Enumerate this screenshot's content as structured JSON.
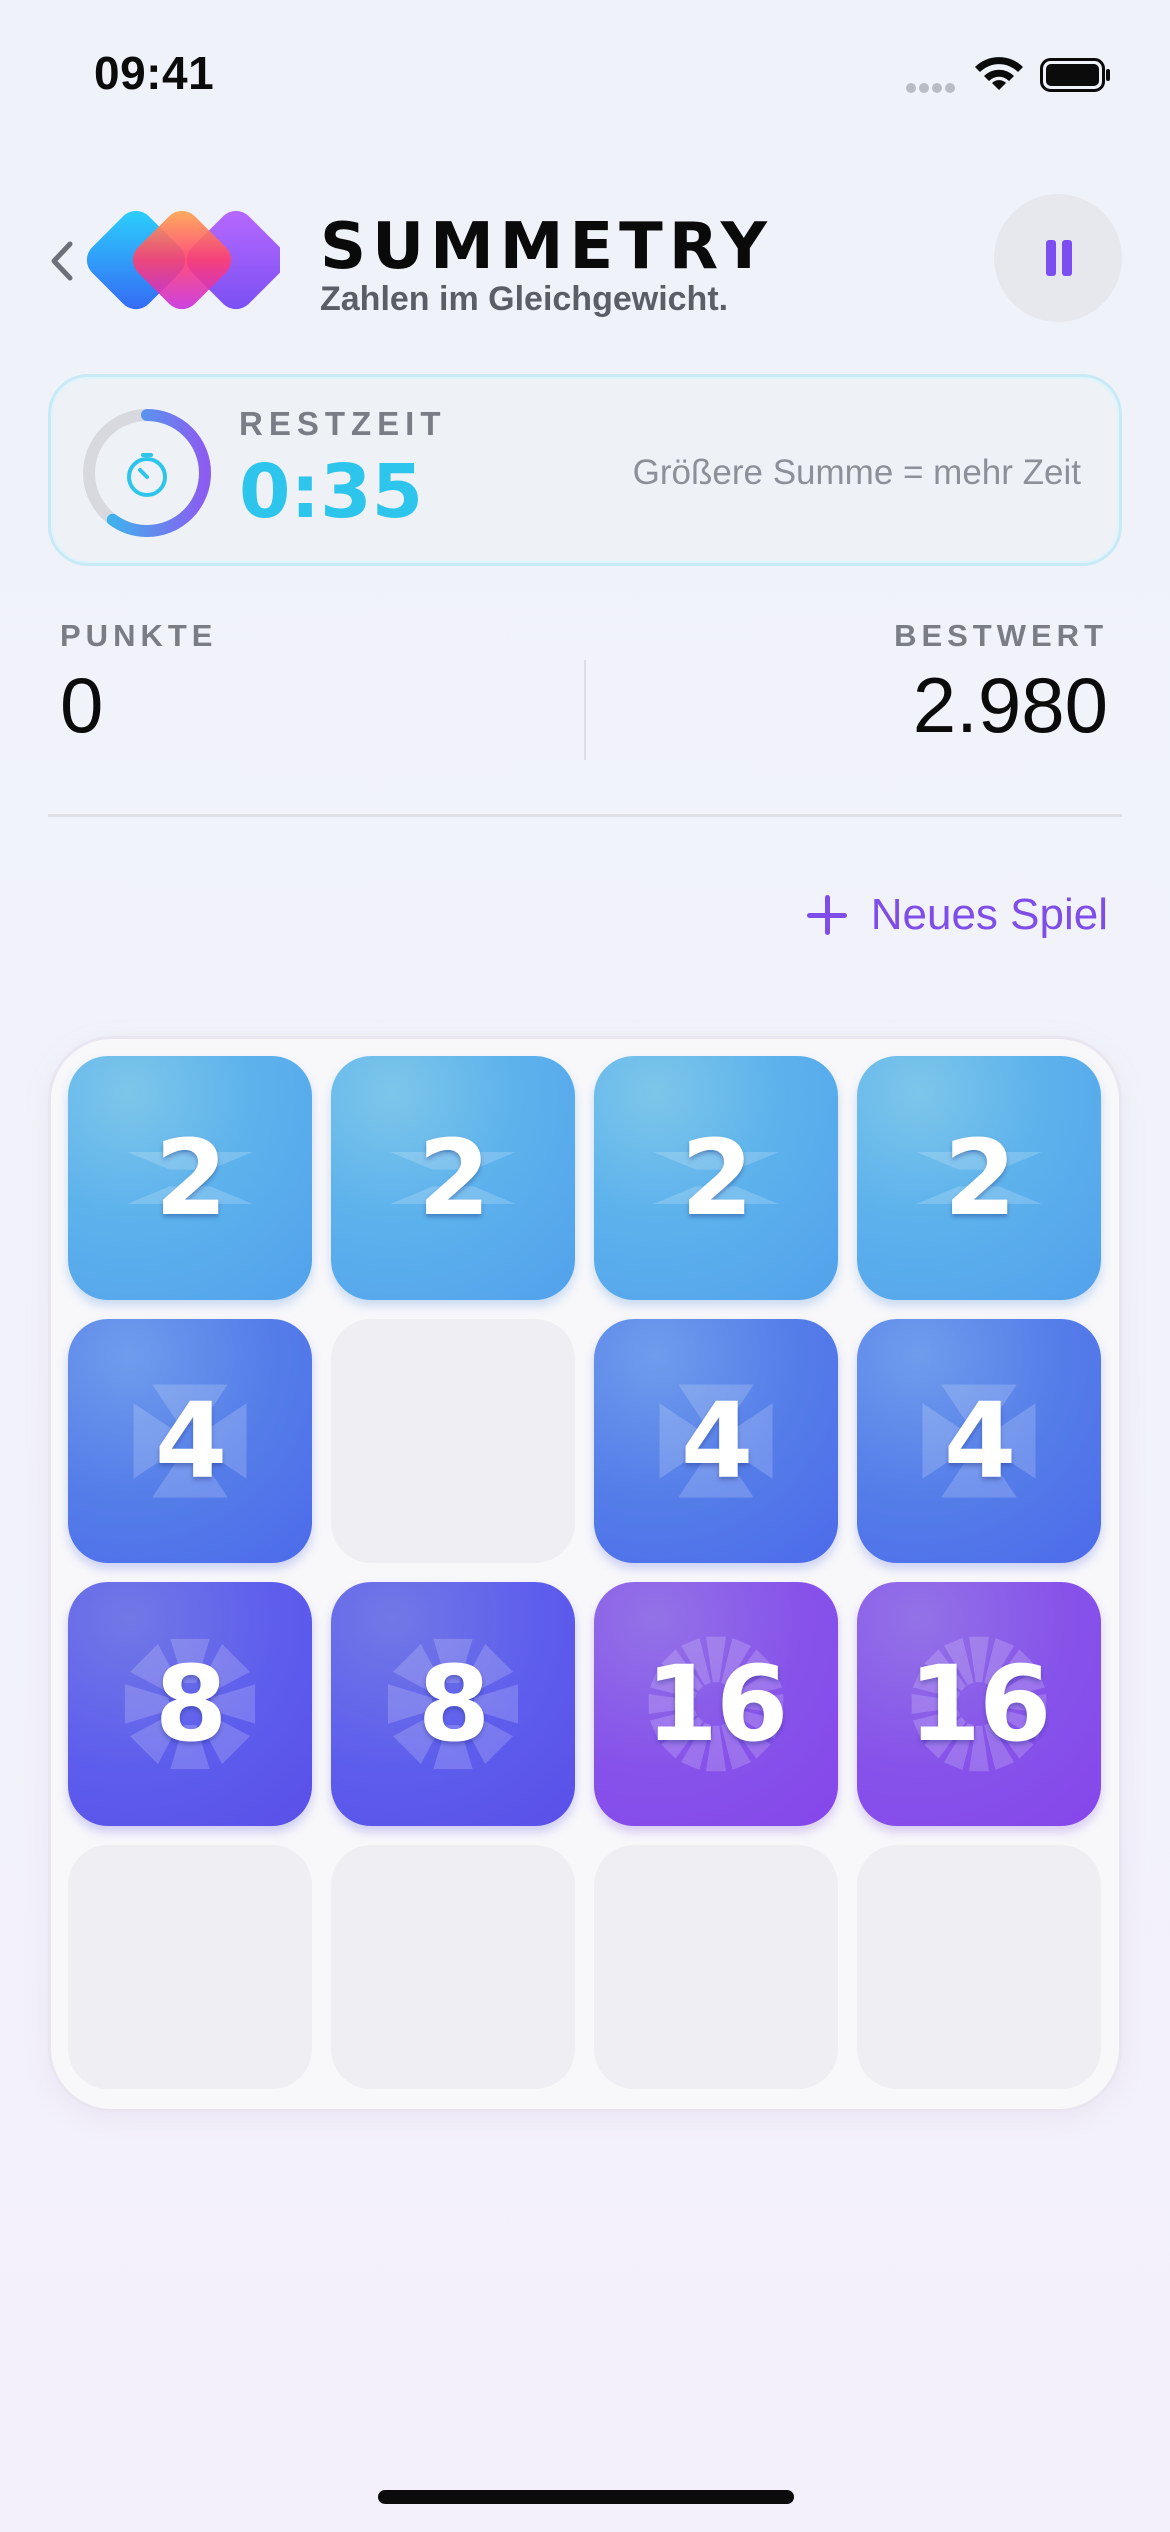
{
  "status_bar": {
    "time": "09:41"
  },
  "header": {
    "title": "SUMMETRY",
    "subtitle": "Zahlen im Gleichgewicht."
  },
  "timer": {
    "label": "RESTZEIT",
    "value": "0:35",
    "hint": "Größere Summe = mehr Zeit",
    "fraction_remaining": 0.6
  },
  "scores": {
    "points_label": "PUNKTE",
    "points_value": "0",
    "best_label": "BESTWERT",
    "best_value": "2.980"
  },
  "actions": {
    "new_game_label": "Neues Spiel"
  },
  "board": {
    "rows": [
      [
        "2",
        "2",
        "2",
        "2"
      ],
      [
        "4",
        "",
        "4",
        "4"
      ],
      [
        "8",
        "8",
        "16",
        "16"
      ],
      [
        "",
        "",
        "",
        ""
      ]
    ]
  },
  "colors": {
    "accent": "#7f4de8",
    "timer": "#2ec5ec",
    "tile_2": "#5db2ec",
    "tile_4": "#557ee9",
    "tile_8": "#5d5ded",
    "tile_16": "#8652ea"
  },
  "icons": {
    "back": "chevron-left-icon",
    "pause": "pause-icon",
    "stopwatch": "stopwatch-icon",
    "new_game": "plus-icon",
    "wifi": "wifi-icon",
    "battery": "battery-icon"
  }
}
